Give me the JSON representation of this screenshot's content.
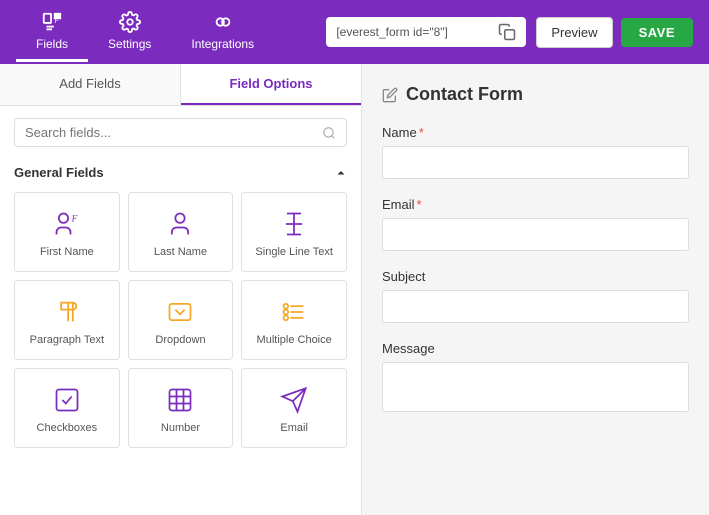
{
  "nav": {
    "items": [
      {
        "id": "fields",
        "label": "Fields",
        "active": true
      },
      {
        "id": "settings",
        "label": "Settings",
        "active": false
      },
      {
        "id": "integrations",
        "label": "Integrations",
        "active": false
      }
    ],
    "shortcode": "[everest_form id=\"8\"]",
    "preview_label": "Preview",
    "save_label": "SAVE"
  },
  "left_panel": {
    "tabs": [
      {
        "id": "add-fields",
        "label": "Add Fields",
        "active": false
      },
      {
        "id": "field-options",
        "label": "Field Options",
        "active": true
      }
    ],
    "search": {
      "placeholder": "Search fields...",
      "value": ""
    },
    "section_label": "General Fields",
    "fields": [
      {
        "id": "first-name",
        "label": "First Name",
        "icon": "person-f"
      },
      {
        "id": "last-name",
        "label": "Last Name",
        "icon": "person"
      },
      {
        "id": "single-line",
        "label": "Single Line Text",
        "icon": "text-T"
      },
      {
        "id": "paragraph",
        "label": "Paragraph Text",
        "icon": "paragraph"
      },
      {
        "id": "dropdown",
        "label": "Dropdown",
        "icon": "chevron-box"
      },
      {
        "id": "multiple-choice",
        "label": "Multiple Choice",
        "icon": "radio-list"
      },
      {
        "id": "checkboxes",
        "label": "Checkboxes",
        "icon": "checkbox"
      },
      {
        "id": "number",
        "label": "Number",
        "icon": "hash"
      },
      {
        "id": "email",
        "label": "Email",
        "icon": "paper-plane"
      }
    ]
  },
  "right_panel": {
    "edit_icon": "pencil",
    "form_title": "Contact Form",
    "form_fields": [
      {
        "id": "name",
        "label": "Name",
        "required": true,
        "type": "text"
      },
      {
        "id": "email",
        "label": "Email",
        "required": true,
        "type": "text"
      },
      {
        "id": "subject",
        "label": "Subject",
        "required": false,
        "type": "text"
      },
      {
        "id": "message",
        "label": "Message",
        "required": false,
        "type": "textarea"
      }
    ]
  },
  "colors": {
    "accent": "#7b2cbf",
    "green": "#28a745",
    "required": "#e74c3c"
  }
}
